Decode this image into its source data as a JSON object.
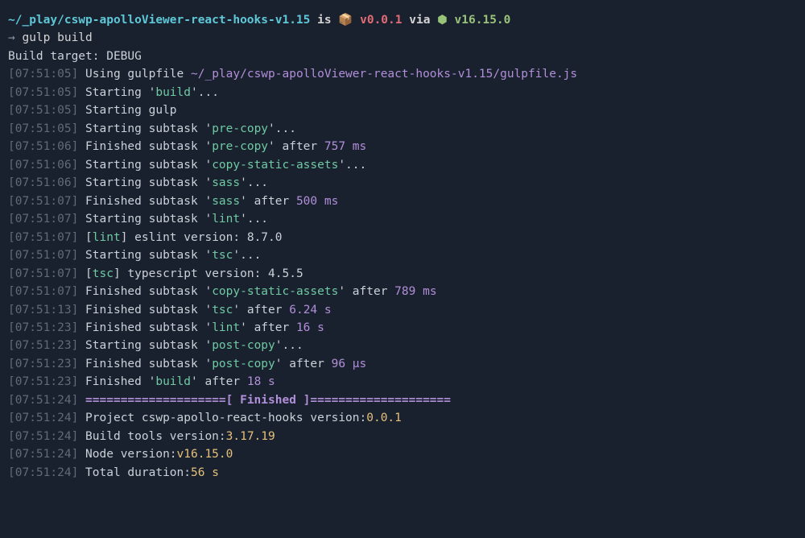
{
  "prompt": {
    "cwd": "~/_play/cswp-apolloViewer-react-hooks-v1.15",
    "is": " is ",
    "box": "📦 ",
    "pkgVersion": "v0.0.1",
    "via": " via ",
    "hex": "⬢ ",
    "nodeVersion": "v16.15.0",
    "arrow": "→ ",
    "command": "gulp build"
  },
  "buildTarget": "Build target: DEBUG",
  "lines": [
    {
      "ts": "[07:51:05]",
      "parts": [
        {
          "t": "kw",
          "v": " Using gulpfile "
        },
        {
          "t": "gulpfile",
          "v": "~/_play/cswp-apolloViewer-react-hooks-v1.15/gulpfile.js"
        }
      ]
    },
    {
      "ts": "[07:51:05]",
      "parts": [
        {
          "t": "kw",
          "v": " Starting '"
        },
        {
          "t": "task",
          "v": "build"
        },
        {
          "t": "kw",
          "v": "'..."
        }
      ]
    },
    {
      "ts": "[07:51:05]",
      "parts": [
        {
          "t": "kw",
          "v": " Starting gulp"
        }
      ]
    },
    {
      "ts": "[07:51:05]",
      "parts": [
        {
          "t": "kw",
          "v": " Starting subtask '"
        },
        {
          "t": "task",
          "v": "pre-copy"
        },
        {
          "t": "kw",
          "v": "'..."
        }
      ]
    },
    {
      "ts": "[07:51:06]",
      "parts": [
        {
          "t": "kw",
          "v": " Finished subtask '"
        },
        {
          "t": "task",
          "v": "pre-copy"
        },
        {
          "t": "kw",
          "v": "' after "
        },
        {
          "t": "dur",
          "v": "757 ms"
        }
      ]
    },
    {
      "ts": "[07:51:06]",
      "parts": [
        {
          "t": "kw",
          "v": " Starting subtask '"
        },
        {
          "t": "task",
          "v": "copy-static-assets"
        },
        {
          "t": "kw",
          "v": "'..."
        }
      ]
    },
    {
      "ts": "[07:51:06]",
      "parts": [
        {
          "t": "kw",
          "v": " Starting subtask '"
        },
        {
          "t": "task",
          "v": "sass"
        },
        {
          "t": "kw",
          "v": "'..."
        }
      ]
    },
    {
      "ts": "[07:51:07]",
      "parts": [
        {
          "t": "kw",
          "v": " Finished subtask '"
        },
        {
          "t": "task",
          "v": "sass"
        },
        {
          "t": "kw",
          "v": "' after "
        },
        {
          "t": "dur",
          "v": "500 ms"
        }
      ]
    },
    {
      "ts": "[07:51:07]",
      "parts": [
        {
          "t": "kw",
          "v": " Starting subtask '"
        },
        {
          "t": "task",
          "v": "lint"
        },
        {
          "t": "kw",
          "v": "'..."
        }
      ]
    },
    {
      "ts": "[07:51:07]",
      "parts": [
        {
          "t": "kw",
          "v": " ["
        },
        {
          "t": "toolname",
          "v": "lint"
        },
        {
          "t": "kw",
          "v": "] eslint version: 8.7.0"
        }
      ]
    },
    {
      "ts": "[07:51:07]",
      "parts": [
        {
          "t": "kw",
          "v": " Starting subtask '"
        },
        {
          "t": "task",
          "v": "tsc"
        },
        {
          "t": "kw",
          "v": "'..."
        }
      ]
    },
    {
      "ts": "[07:51:07]",
      "parts": [
        {
          "t": "kw",
          "v": " ["
        },
        {
          "t": "toolname",
          "v": "tsc"
        },
        {
          "t": "kw",
          "v": "] typescript version: 4.5.5"
        }
      ]
    },
    {
      "ts": "[07:51:07]",
      "parts": [
        {
          "t": "kw",
          "v": " Finished subtask '"
        },
        {
          "t": "task",
          "v": "copy-static-assets"
        },
        {
          "t": "kw",
          "v": "' after "
        },
        {
          "t": "dur",
          "v": "789 ms"
        }
      ]
    },
    {
      "ts": "[07:51:13]",
      "parts": [
        {
          "t": "kw",
          "v": " Finished subtask '"
        },
        {
          "t": "task",
          "v": "tsc"
        },
        {
          "t": "kw",
          "v": "' after "
        },
        {
          "t": "dur",
          "v": "6.24 s"
        }
      ]
    },
    {
      "ts": "[07:51:23]",
      "parts": [
        {
          "t": "kw",
          "v": " Finished subtask '"
        },
        {
          "t": "task",
          "v": "lint"
        },
        {
          "t": "kw",
          "v": "' after "
        },
        {
          "t": "dur",
          "v": "16 s"
        }
      ]
    },
    {
      "ts": "[07:51:23]",
      "parts": [
        {
          "t": "kw",
          "v": " Starting subtask '"
        },
        {
          "t": "task",
          "v": "post-copy"
        },
        {
          "t": "kw",
          "v": "'..."
        }
      ]
    },
    {
      "ts": "[07:51:23]",
      "parts": [
        {
          "t": "kw",
          "v": " Finished subtask '"
        },
        {
          "t": "task",
          "v": "post-copy"
        },
        {
          "t": "kw",
          "v": "' after "
        },
        {
          "t": "dur",
          "v": "96 μs"
        }
      ]
    },
    {
      "ts": "[07:51:23]",
      "parts": [
        {
          "t": "kw",
          "v": " Finished '"
        },
        {
          "t": "task",
          "v": "build"
        },
        {
          "t": "kw",
          "v": "' after "
        },
        {
          "t": "dur",
          "v": "18 s"
        }
      ]
    },
    {
      "ts": "[07:51:24]",
      "parts": [
        {
          "t": "finished-bar",
          "v": " ====================[ Finished ]===================="
        }
      ]
    },
    {
      "ts": "[07:51:24]",
      "parts": [
        {
          "t": "kw",
          "v": " Project cswp-apollo-react-hooks version:"
        },
        {
          "t": "yellow",
          "v": "0.0.1"
        }
      ]
    },
    {
      "ts": "[07:51:24]",
      "parts": [
        {
          "t": "kw",
          "v": " Build tools version:"
        },
        {
          "t": "yellow",
          "v": "3.17.19"
        }
      ]
    },
    {
      "ts": "[07:51:24]",
      "parts": [
        {
          "t": "kw",
          "v": " Node version:"
        },
        {
          "t": "yellow",
          "v": "v16.15.0"
        }
      ]
    },
    {
      "ts": "[07:51:24]",
      "parts": [
        {
          "t": "kw",
          "v": " Total duration:"
        },
        {
          "t": "yellow",
          "v": "56 s"
        }
      ]
    }
  ]
}
